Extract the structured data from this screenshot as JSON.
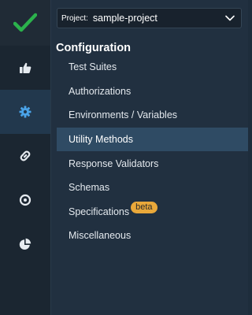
{
  "colors": {
    "accent_green": "#2bb24c",
    "rail_icon": "#e6ebf0",
    "active_rail_icon": "#4aa3e8",
    "badge_bg": "#e9a83a"
  },
  "rail": {
    "logo_icon": "checkmark-icon",
    "items": [
      {
        "icon": "thumbs-up-icon",
        "active": false
      },
      {
        "icon": "gear-icon",
        "active": true
      },
      {
        "icon": "link-icon",
        "active": false
      },
      {
        "icon": "disc-icon",
        "active": false
      },
      {
        "icon": "pie-chart-icon",
        "active": false
      }
    ]
  },
  "project": {
    "label": "Project:",
    "value": "sample-project"
  },
  "section": {
    "title": "Configuration"
  },
  "menu": {
    "items": [
      {
        "label": "Test Suites",
        "active": false
      },
      {
        "label": "Authorizations",
        "active": false
      },
      {
        "label": "Environments / Variables",
        "active": false
      },
      {
        "label": "Utility Methods",
        "active": true
      },
      {
        "label": "Response Validators",
        "active": false
      },
      {
        "label": "Schemas",
        "active": false
      },
      {
        "label": "Specifications",
        "active": false,
        "badge": "beta"
      },
      {
        "label": "Miscellaneous",
        "active": false
      }
    ]
  }
}
